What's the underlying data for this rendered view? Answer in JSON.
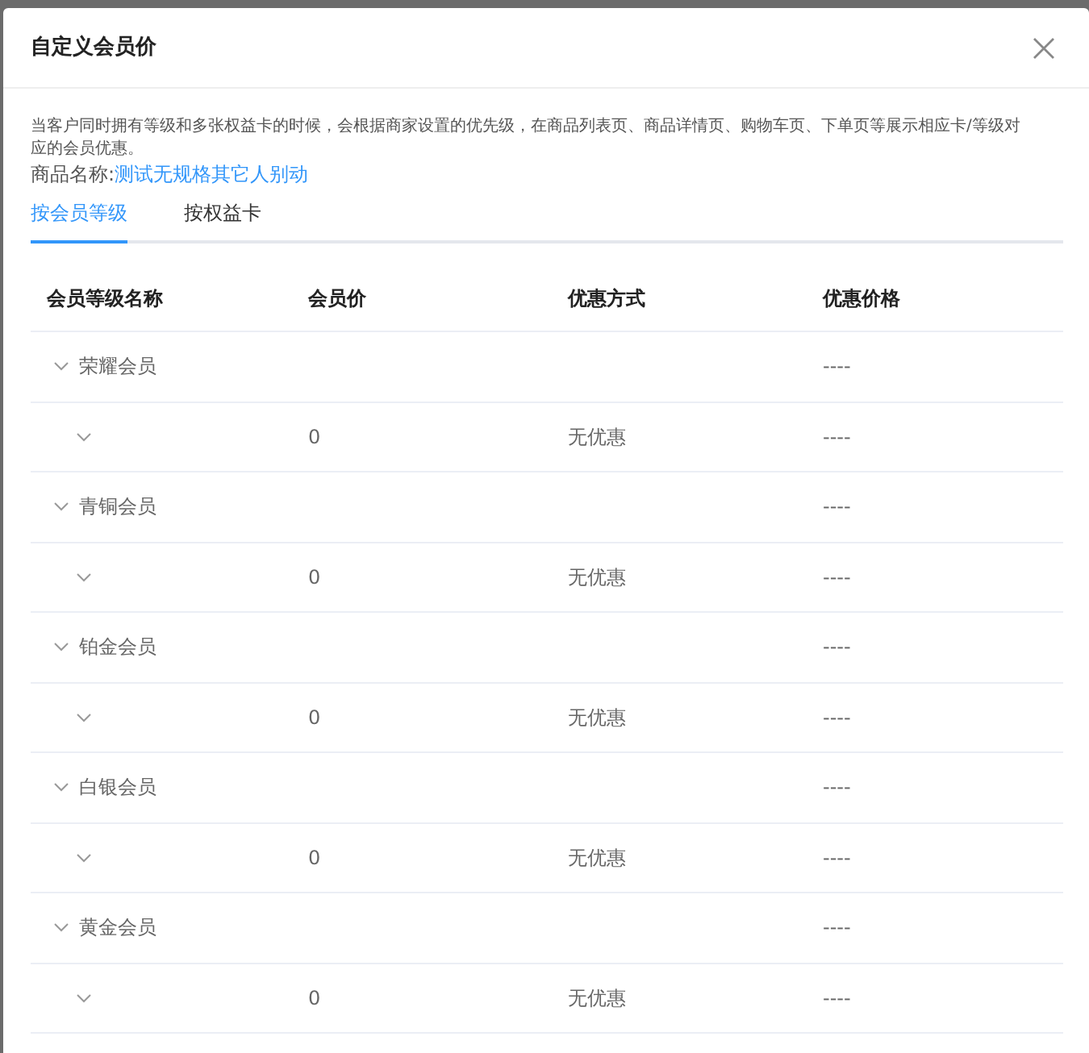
{
  "dialog": {
    "title": "自定义会员价",
    "notice": "当客户同时拥有等级和多张权益卡的时候，会根据商家设置的优先级，在商品列表页、商品详情页、购物车页、下单页等展示相应卡/等级对应的会员优惠。",
    "product_label": "商品名称:",
    "product_name": "测试无规格其它人别动"
  },
  "tabs": [
    {
      "label": "按会员等级",
      "selected": true
    },
    {
      "label": "按权益卡",
      "selected": false
    }
  ],
  "table": {
    "columns": [
      "会员等级名称",
      "会员价",
      "优惠方式",
      "优惠价格"
    ],
    "rows": [
      {
        "name": "荣耀会员",
        "price": "----",
        "expanded": true,
        "children": [
          {
            "member_price": "0",
            "discount_type": "无优惠",
            "price": "----"
          }
        ]
      },
      {
        "name": "青铜会员",
        "price": "----",
        "expanded": true,
        "children": [
          {
            "member_price": "0",
            "discount_type": "无优惠",
            "price": "----"
          }
        ]
      },
      {
        "name": "铂金会员",
        "price": "----",
        "expanded": true,
        "children": [
          {
            "member_price": "0",
            "discount_type": "无优惠",
            "price": "----"
          }
        ]
      },
      {
        "name": "白银会员",
        "price": "----",
        "expanded": true,
        "children": [
          {
            "member_price": "0",
            "discount_type": "无优惠",
            "price": "----"
          }
        ]
      },
      {
        "name": "黄金会员",
        "price": "----",
        "expanded": true,
        "children": [
          {
            "member_price": "0",
            "discount_type": "无优惠",
            "price": "----"
          }
        ]
      }
    ]
  }
}
